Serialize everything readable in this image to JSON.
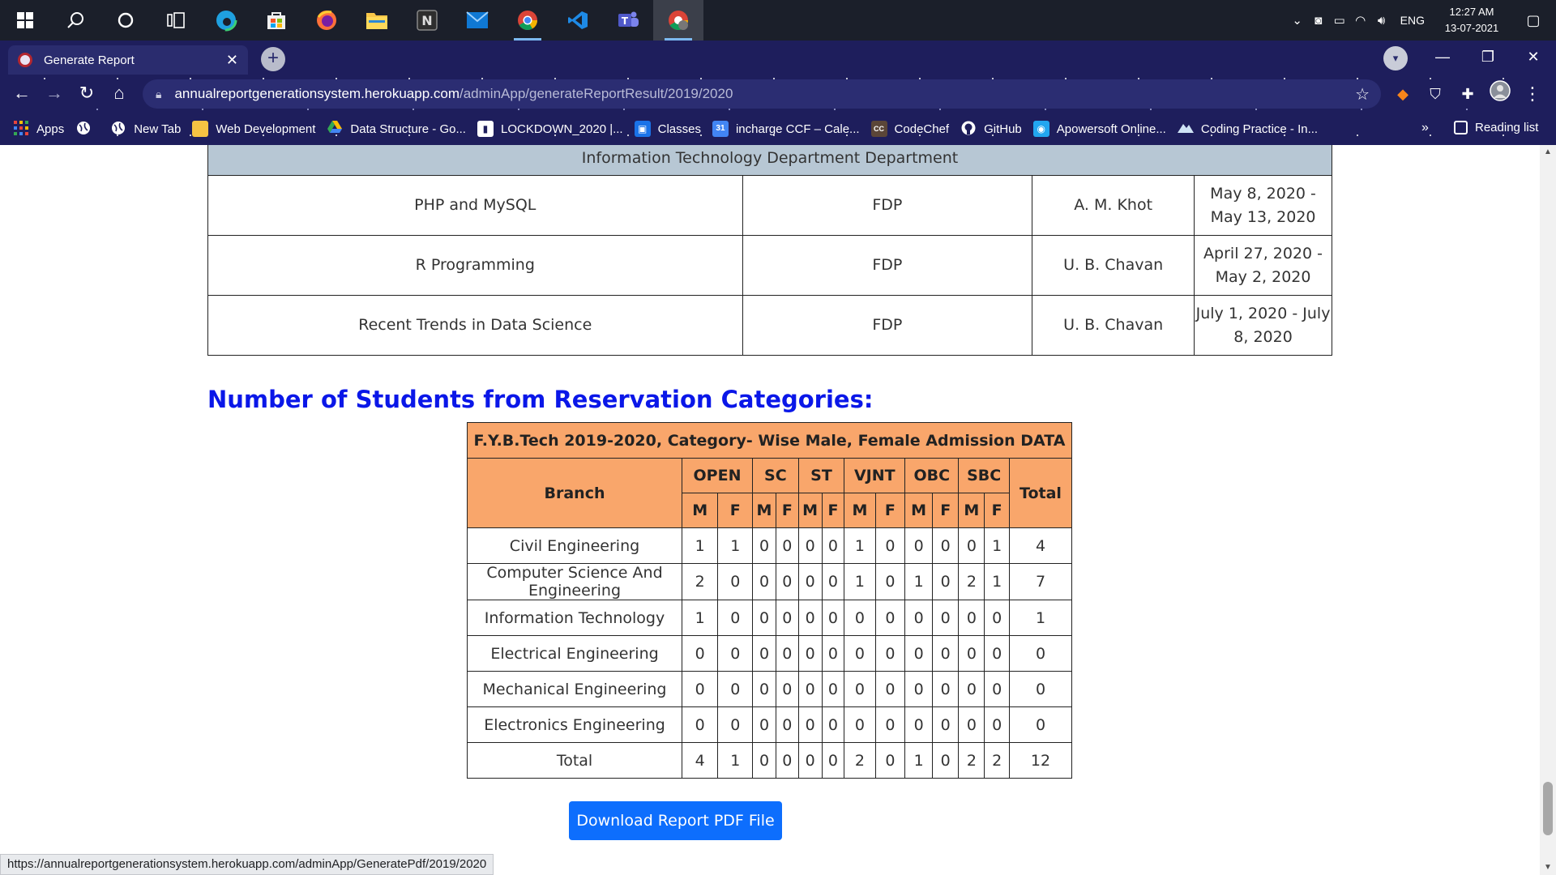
{
  "taskbar": {
    "apps": [
      "start",
      "search",
      "cortana",
      "task-view",
      "edge",
      "store",
      "firefox",
      "file-explorer",
      "notion",
      "mail",
      "chrome",
      "vscode",
      "teams",
      "chrome-profile"
    ],
    "tray": {
      "lang": "ENG",
      "time": "12:27 AM",
      "date": "13-07-2021"
    }
  },
  "browser": {
    "tab": {
      "title": "Generate Report"
    },
    "address": {
      "host": "annualreportgenerationsystem.herokuapp.com",
      "path": "/adminApp/generateReportResult/2019/2020"
    },
    "bookmarks": [
      {
        "label": "Apps",
        "icon": "apps-grid-icon",
        "color": "#e8453c"
      },
      {
        "label": "",
        "icon": "globe-icon",
        "color": "#ffffff"
      },
      {
        "label": "New Tab",
        "icon": "globe-icon",
        "color": "#ffffff"
      },
      {
        "label": "Web Development",
        "icon": "folder-icon",
        "color": "#f6c343"
      },
      {
        "label": "Data Structure - Go...",
        "icon": "drive-icon",
        "color": "#34a853"
      },
      {
        "label": "LOCKDOWN_2020 |...",
        "icon": "bookmark-icon",
        "color": "#ffffff"
      },
      {
        "label": "Classes",
        "icon": "classroom-icon",
        "color": "#1a73e8"
      },
      {
        "label": "incharge CCF – Cale...",
        "icon": "calendar-icon",
        "color": "#4285f4"
      },
      {
        "label": "CodeChef",
        "icon": "codechef-icon",
        "color": "#5b4638"
      },
      {
        "label": "GitHub",
        "icon": "github-icon",
        "color": "#ffffff"
      },
      {
        "label": "Apowersoft Online...",
        "icon": "apowersoft-icon",
        "color": "#22a6f0"
      },
      {
        "label": "Coding Practice - In...",
        "icon": "mountain-icon",
        "color": "#cfe3f5"
      }
    ],
    "bookmarks_more": "»",
    "reading_list": "Reading list",
    "status_url": "https://annualreportgenerationsystem.herokuapp.com/adminApp/GeneratePdf/2019/2020"
  },
  "fdp": {
    "department": "Information Technology Department Department",
    "rows": [
      {
        "title": "PHP and MySQL",
        "type": "FDP",
        "coordinator": "A. M. Khot",
        "dates": "May 8, 2020 - May 13, 2020"
      },
      {
        "title": "R Programming",
        "type": "FDP",
        "coordinator": "U. B. Chavan",
        "dates": "April 27, 2020 - May 2, 2020"
      },
      {
        "title": "Recent Trends in Data Science",
        "type": "FDP",
        "coordinator": "U. B. Chavan",
        "dates": "July 1, 2020 - July 8, 2020"
      }
    ]
  },
  "reservation": {
    "section_title": "Number of Students from Reservation Categories:",
    "caption": "F.Y.B.Tech 2019-2020, Category- Wise Male, Female Admission DATA",
    "branch_header": "Branch",
    "total_header": "Total",
    "categories": [
      "OPEN",
      "SC",
      "ST",
      "VJNT",
      "OBC",
      "SBC"
    ],
    "sub_headers": [
      "M",
      "F"
    ],
    "rows": [
      {
        "branch": "Civil Engineering",
        "values": [
          1,
          1,
          0,
          0,
          0,
          0,
          1,
          0,
          0,
          0,
          0,
          1
        ],
        "total": 4
      },
      {
        "branch": "Computer Science And Engineering",
        "values": [
          2,
          0,
          0,
          0,
          0,
          0,
          1,
          0,
          1,
          0,
          2,
          1
        ],
        "total": 7
      },
      {
        "branch": "Information Technology",
        "values": [
          1,
          0,
          0,
          0,
          0,
          0,
          0,
          0,
          0,
          0,
          0,
          0
        ],
        "total": 1
      },
      {
        "branch": "Electrical Engineering",
        "values": [
          0,
          0,
          0,
          0,
          0,
          0,
          0,
          0,
          0,
          0,
          0,
          0
        ],
        "total": 0
      },
      {
        "branch": "Mechanical Engineering",
        "values": [
          0,
          0,
          0,
          0,
          0,
          0,
          0,
          0,
          0,
          0,
          0,
          0
        ],
        "total": 0
      },
      {
        "branch": "Electronics Engineering",
        "values": [
          0,
          0,
          0,
          0,
          0,
          0,
          0,
          0,
          0,
          0,
          0,
          0
        ],
        "total": 0
      },
      {
        "branch": "Total",
        "values": [
          4,
          1,
          0,
          0,
          0,
          0,
          2,
          0,
          1,
          0,
          2,
          2
        ],
        "total": 12
      }
    ]
  },
  "download_button": "Download Report PDF File"
}
